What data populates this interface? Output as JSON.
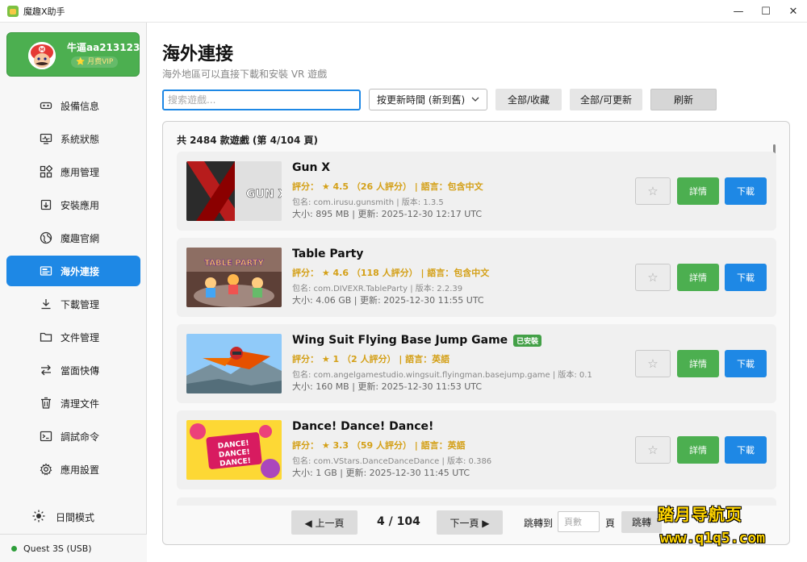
{
  "window": {
    "title": "魔趣X助手",
    "min": "—",
    "max": "☐",
    "close": "✕"
  },
  "user": {
    "name": "牛逼aa213123",
    "badge": "⭐ 月费VIP"
  },
  "sidebar": {
    "items": [
      {
        "label": "設備信息",
        "icon": "device-info-icon"
      },
      {
        "label": "系統狀態",
        "icon": "system-status-icon"
      },
      {
        "label": "應用管理",
        "icon": "apps-grid-icon"
      },
      {
        "label": "安裝應用",
        "icon": "install-icon"
      },
      {
        "label": "魔趣官網",
        "icon": "globe-icon"
      },
      {
        "label": "海外連接",
        "icon": "overseas-icon",
        "active": true
      },
      {
        "label": "下載管理",
        "icon": "download-icon"
      },
      {
        "label": "文件管理",
        "icon": "folder-icon"
      },
      {
        "label": "當面快傳",
        "icon": "transfer-icon"
      },
      {
        "label": "清理文件",
        "icon": "trash-icon"
      },
      {
        "label": "調試命令",
        "icon": "terminal-icon"
      },
      {
        "label": "應用設置",
        "icon": "settings-icon"
      }
    ],
    "day_mode": "日間模式",
    "device_status": "Quest 3S (USB)"
  },
  "main": {
    "title": "海外連接",
    "subtitle": "海外地區可以直接下載和安裝 VR 遊戲",
    "search_placeholder": "搜索遊戲...",
    "sort_value": "按更新時間 (新到舊)",
    "filter_fav": "全部/收藏",
    "filter_update": "全部/可更新",
    "refresh": "刷新",
    "count_text": "共 2484 款遊戲 (第 4/104 頁)",
    "star": "☆",
    "detail_label": "詳情",
    "download_label": "下載",
    "games": [
      {
        "title": "Gun X",
        "installed": "",
        "meta": "評分： ★ 4.5 （26 人評分） | 語言：包含中文",
        "pkg": "包名: com.irusu.gunsmith | 版本: 1.3.5",
        "size": "大小: 895 MB  |  更新: 2025-12-30 12:17 UTC",
        "thumb_text": "GUN X"
      },
      {
        "title": "Table Party",
        "installed": "",
        "meta": "評分： ★ 4.6 （118 人評分） | 語言：包含中文",
        "pkg": "包名: com.DIVEXR.TableParty | 版本: 2.2.39",
        "size": "大小: 4.06 GB  |  更新: 2025-12-30 11:55 UTC",
        "thumb_text": "TABLE PARTY"
      },
      {
        "title": "Wing Suit Flying Base Jump Game",
        "installed": "已安裝",
        "meta": "評分： ★ 1 （2 人評分） | 語言：英語",
        "pkg": "包名: com.angelgamestudio.wingsuit.flyingman.basejump.game | 版本: 0.1",
        "size": "大小: 160 MB  |  更新: 2025-12-30 11:53 UTC",
        "thumb_text": ""
      },
      {
        "title": "Dance! Dance! Dance!",
        "installed": "",
        "meta": "評分： ★ 3.3 （59 人評分） | 語言：英語",
        "pkg": "包名: com.VStars.DanceDanceDance | 版本: 0.386",
        "size": "大小: 1 GB  |  更新: 2025-12-30 11:45 UTC",
        "thumb_text": "DANCE! DANCE! DANCE!"
      }
    ],
    "pager": {
      "prev": "◀ 上一頁",
      "indicator": "4 / 104",
      "next": "下一頁 ▶",
      "jump_label": "跳轉到",
      "jump_placeholder": "頁數",
      "page_unit": "頁",
      "jump_button": "跳轉"
    }
  },
  "watermark": {
    "line1": "踏月导航页",
    "line2": "www.q1q5.com"
  }
}
